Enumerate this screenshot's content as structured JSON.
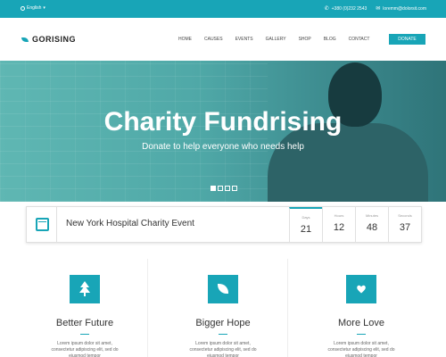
{
  "topbar": {
    "language": "English",
    "phone": "+380 (0)232 2543",
    "email": "loremm@dolorsit.com"
  },
  "header": {
    "logo": "GORISING",
    "nav": [
      "HOME",
      "CAUSES",
      "EVENTS",
      "GALLERY",
      "SHOP",
      "BLOG",
      "CONTACT"
    ],
    "donate_label": "DONATE"
  },
  "hero": {
    "title": "Charity Fundrising",
    "subtitle": "Donate to help everyone who needs help",
    "slides": 4,
    "active_slide": 1
  },
  "event": {
    "title": "New York Hospital Charity Event",
    "countdown": [
      {
        "label": "Days",
        "value": "21"
      },
      {
        "label": "Hours",
        "value": "12"
      },
      {
        "label": "Minutes",
        "value": "48"
      },
      {
        "label": "Seconds",
        "value": "37"
      }
    ]
  },
  "features": [
    {
      "icon": "tree-icon",
      "title": "Better Future",
      "text": "Lorem ipsum dolor sit amet, consectetur adipiscing elit, sed do eiusmod tempor"
    },
    {
      "icon": "leaf-icon",
      "title": "Bigger Hope",
      "text": "Lorem ipsum dolor sit amet, consectetur adipiscing elit, sed do eiusmod tempor"
    },
    {
      "icon": "heart-icon",
      "title": "More Love",
      "text": "Lorem ipsum dolor sit amet, consectetur adipiscing elit, sed do eiusmod tempor"
    }
  ],
  "colors": {
    "accent": "#18a5b7"
  }
}
